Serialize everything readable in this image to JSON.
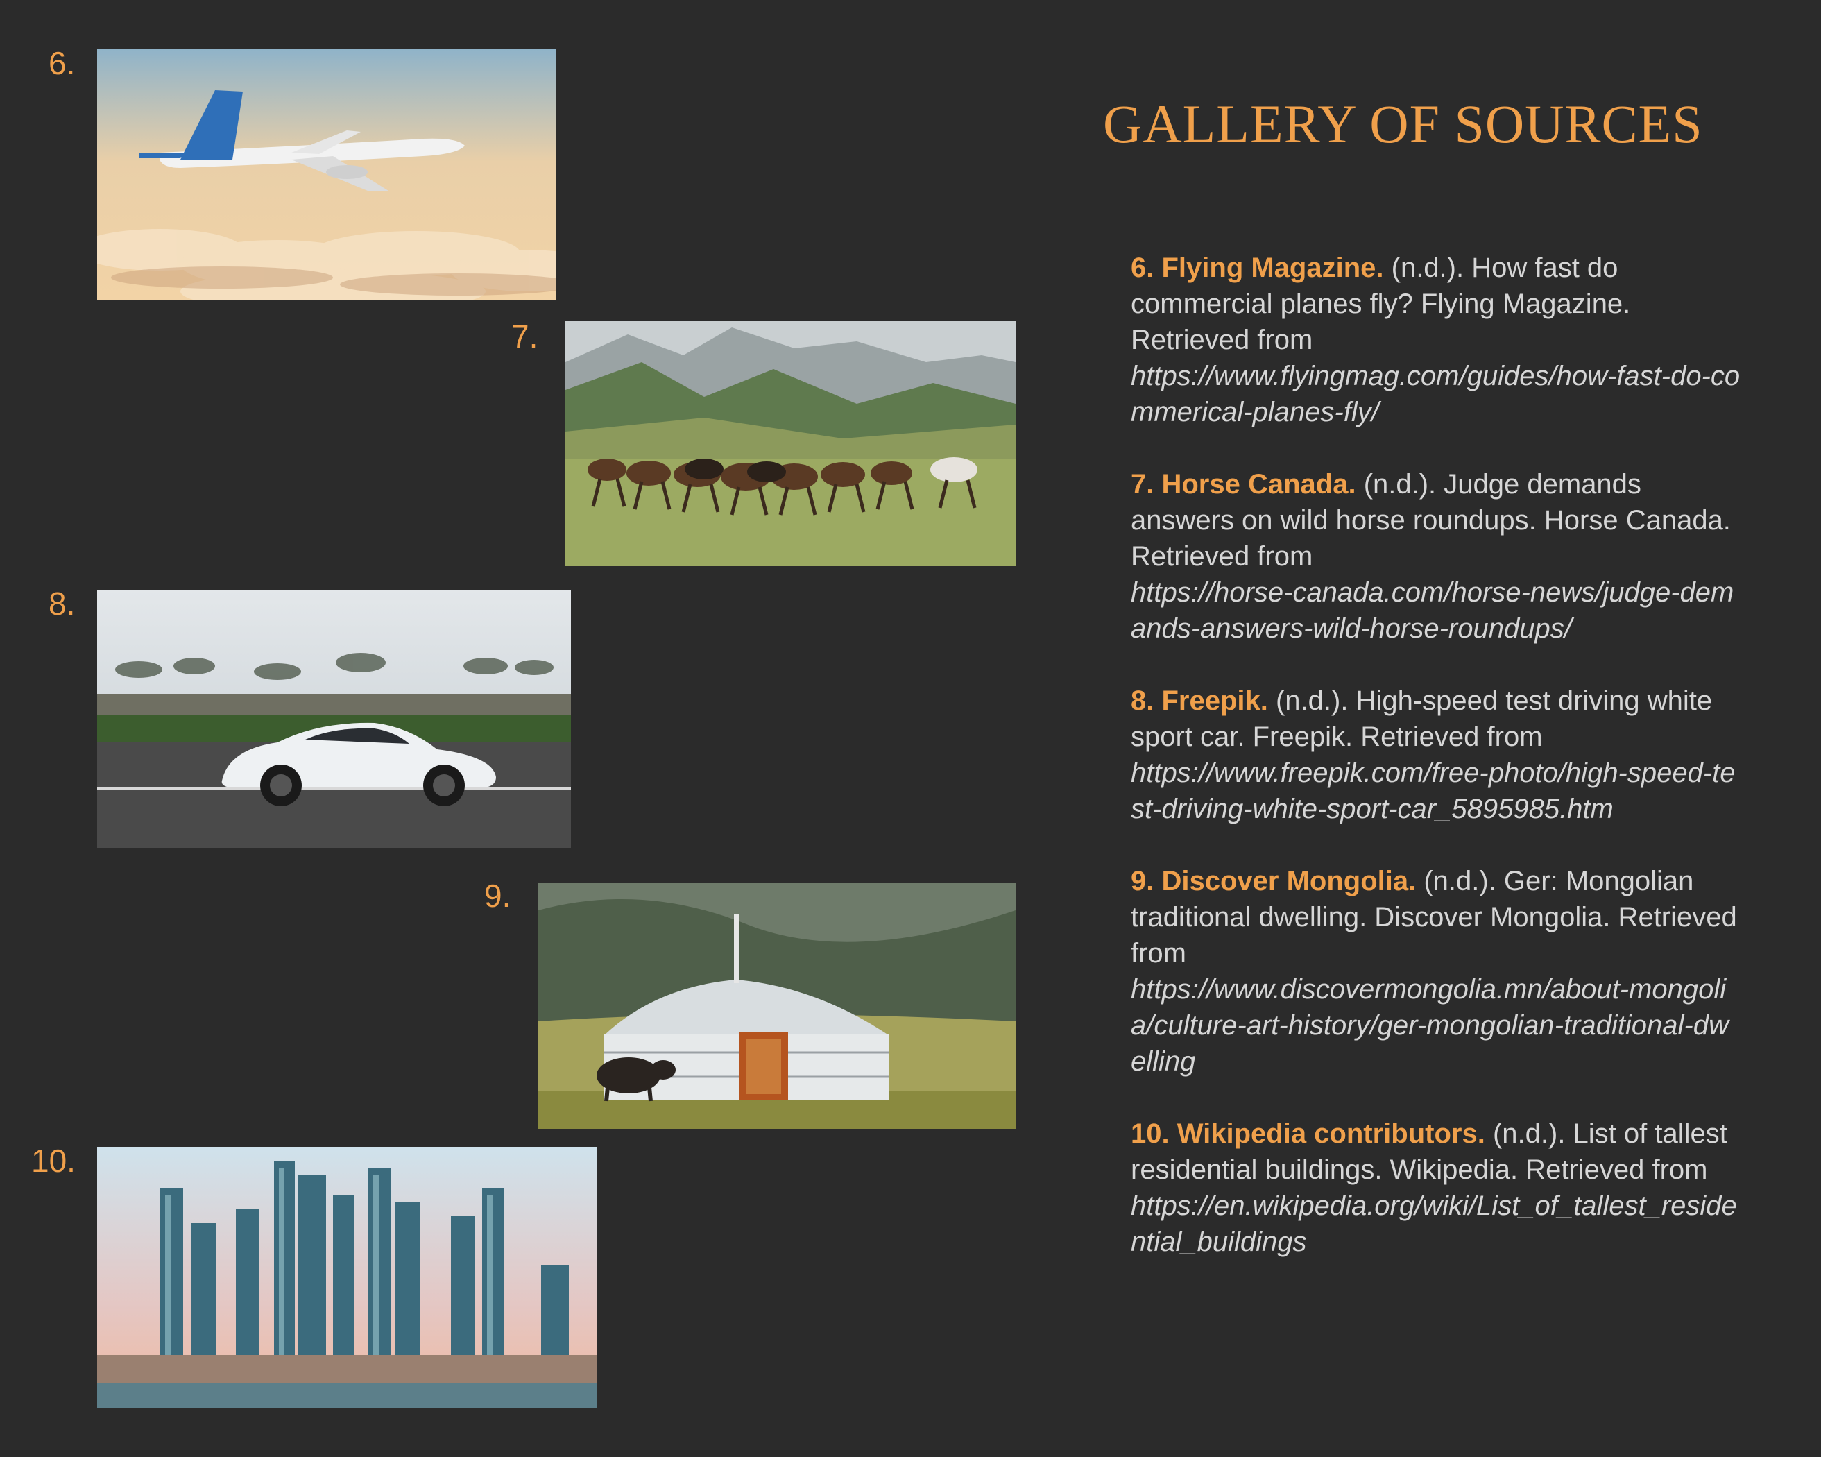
{
  "gallery_title": "GALLERY OF SOURCES",
  "accent_color": "#f0a04b",
  "background_color": "#2b2b2b",
  "images": [
    {
      "number": "6.",
      "subject": "airplane-in-sky"
    },
    {
      "number": "7.",
      "subject": "wild-horses-running"
    },
    {
      "number": "8.",
      "subject": "white-sports-car"
    },
    {
      "number": "9.",
      "subject": "mongolian-ger"
    },
    {
      "number": "10.",
      "subject": "city-skyline"
    }
  ],
  "references": [
    {
      "head": "6. Flying Magazine.",
      "body": " (n.d.). How fast do commercial planes fly? Flying Magazine. Retrieved from",
      "url": "https://www.flyingmag.com/guides/how-fast-do-commerical-planes-fly/"
    },
    {
      "head": "7. Horse Canada.",
      "body": " (n.d.). Judge demands answers on wild horse roundups. Horse Canada. Retrieved from",
      "url": "https://horse-canada.com/horse-news/judge-demands-answers-wild-horse-roundups/"
    },
    {
      "head": "8. Freepik.",
      "body": " (n.d.). High-speed test driving white sport car. Freepik. Retrieved from",
      "url": "https://www.freepik.com/free-photo/high-speed-test-driving-white-sport-car_5895985.htm"
    },
    {
      "head": "9. Discover Mongolia.",
      "body": " (n.d.). Ger: Mongolian traditional dwelling. Discover Mongolia. Retrieved from",
      "url": "https://www.discovermongolia.mn/about-mongolia/culture-art-history/ger-mongolian-traditional-dwelling"
    },
    {
      "head": "10. Wikipedia contributors.",
      "body": " (n.d.). List of tallest residential buildings. Wikipedia. Retrieved from",
      "url": "https://en.wikipedia.org/wiki/List_of_tallest_residential_buildings"
    }
  ]
}
